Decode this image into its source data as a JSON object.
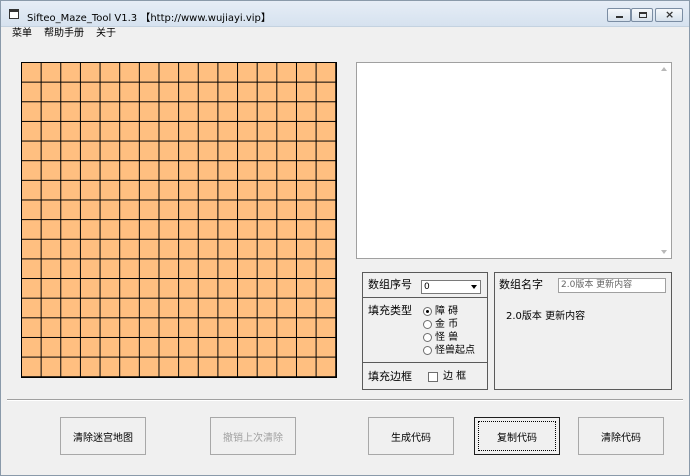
{
  "window": {
    "title": "Sifteo_Maze_Tool   V1.3   【http://www.wujiayi.vip】"
  },
  "menu": {
    "items": [
      "菜单",
      "帮助手册",
      "关于"
    ]
  },
  "maze": {
    "rows": 16,
    "cols": 16,
    "cell_color": "#ffbf80",
    "line_color": "#000000"
  },
  "array_index": {
    "label": "数组序号",
    "value": "0"
  },
  "fill_type": {
    "label": "填充类型",
    "options": [
      {
        "label": "障   碍",
        "selected": true
      },
      {
        "label": "金   币",
        "selected": false
      },
      {
        "label": "怪   兽",
        "selected": false
      },
      {
        "label": "怪兽起点",
        "selected": false
      }
    ]
  },
  "fill_border": {
    "label": "填充边框",
    "checkbox_label": "边   框",
    "checked": false
  },
  "array_name": {
    "label": "数组名字",
    "value": "2.0版本 更新内容",
    "body_text": "2.0版本 更新内容"
  },
  "buttons": {
    "clear_maze": "清除迷宫地图",
    "undo_clear": "撤销上次清除",
    "generate_code": "生成代码",
    "copy_code": "复制代码",
    "clear_code": "清除代码"
  }
}
